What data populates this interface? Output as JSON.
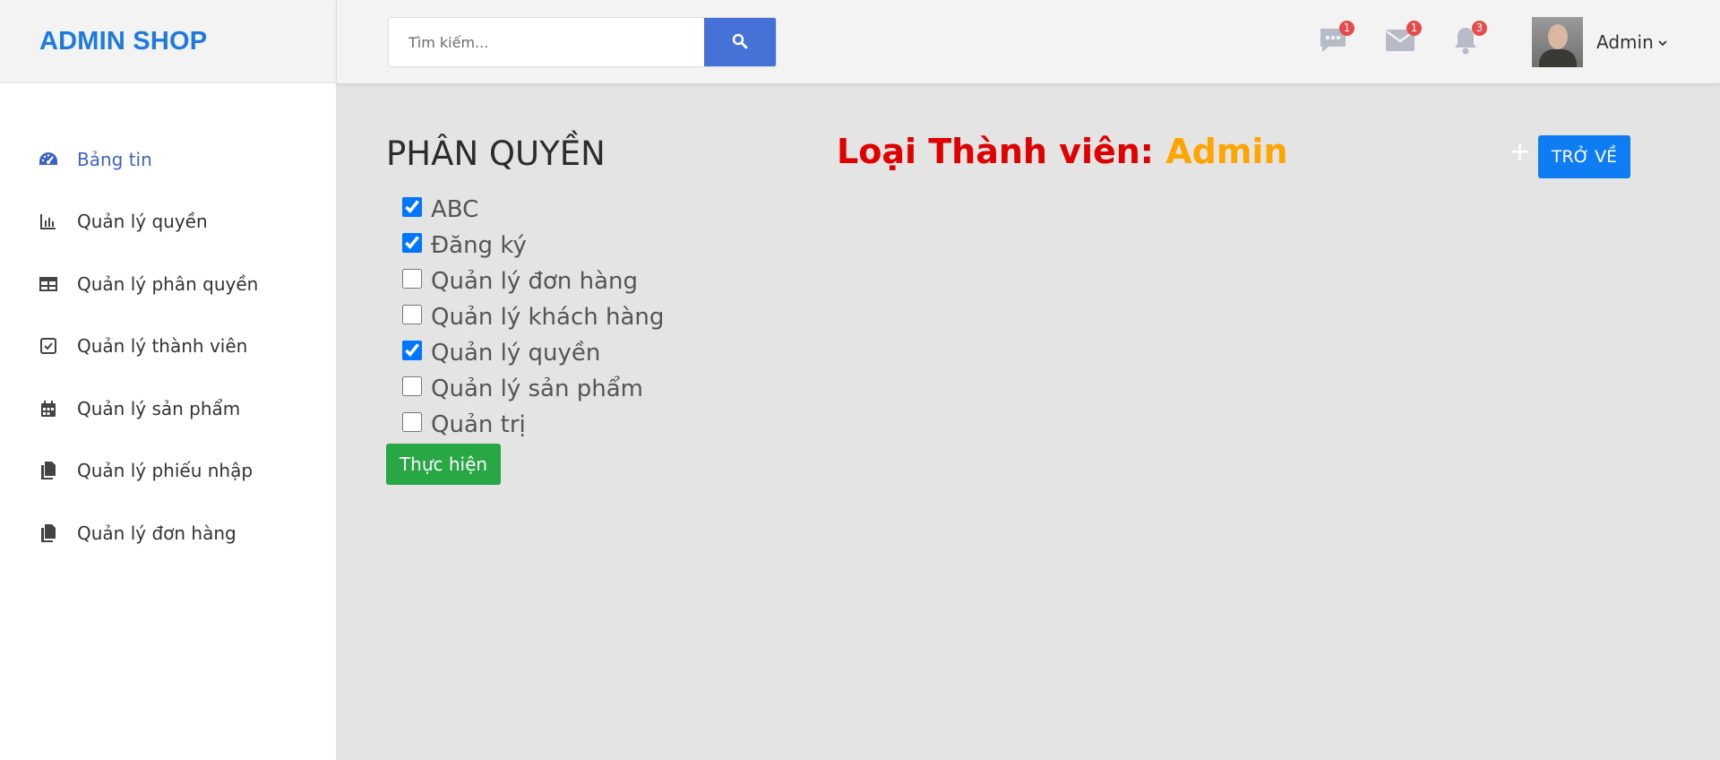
{
  "brand": "ADMIN SHOP",
  "sidebar": {
    "items": [
      {
        "label": "Bảng tin",
        "icon": "dashboard-gauge-icon"
      },
      {
        "label": "Quản lý quyền",
        "icon": "bar-chart-icon"
      },
      {
        "label": "Quản lý phân quyền",
        "icon": "table-icon"
      },
      {
        "label": "Quản lý thành viên",
        "icon": "check-square-icon"
      },
      {
        "label": "Quản lý sản phẩm",
        "icon": "calendar-icon"
      },
      {
        "label": "Quản lý phiếu nhập",
        "icon": "copy-icon"
      },
      {
        "label": "Quản lý đơn hàng",
        "icon": "copy-icon"
      }
    ]
  },
  "header": {
    "search_placeholder": "Tìm kiếm...",
    "badges": {
      "messages": "1",
      "mail": "1",
      "notifications": "3"
    },
    "user_name": "Admin"
  },
  "main": {
    "title": "PHÂN QUYỀN",
    "member_label": "Loại Thành viên: ",
    "member_value": "Admin",
    "plus": "+",
    "back_label": "TRỞ VỀ",
    "permissions": [
      {
        "label": "ABC",
        "checked": true
      },
      {
        "label": "Đăng ký",
        "checked": true
      },
      {
        "label": "Quản lý đơn hàng",
        "checked": false
      },
      {
        "label": "Quản lý khách hàng",
        "checked": false
      },
      {
        "label": "Quản lý quyền",
        "checked": true
      },
      {
        "label": "Quản lý sản phẩm",
        "checked": false
      },
      {
        "label": "Quản trị",
        "checked": false
      }
    ],
    "submit_label": "Thực hiện"
  },
  "colors": {
    "brand": "#1f7ae0",
    "active_menu": "#3d63c9",
    "search_button": "#4672d8",
    "member_label": "#e00000",
    "member_value": "#ffa500",
    "back_button": "#0e7cf2",
    "submit_button": "#28a745",
    "badge": "#e74a4a"
  }
}
